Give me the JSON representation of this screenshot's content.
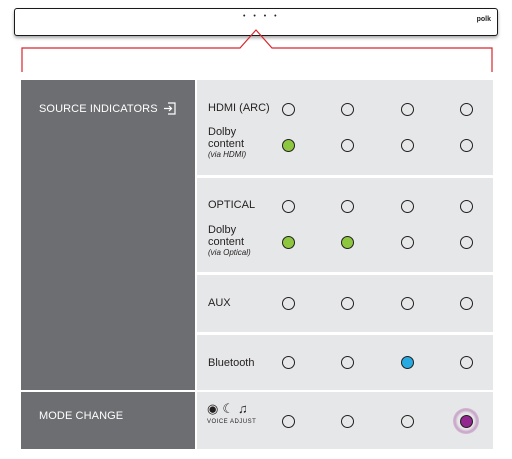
{
  "device": {
    "brand_logo": "polk",
    "dots": "• • • •"
  },
  "labels": {
    "source_indicators": "SOURCE INDICATORS",
    "mode_change": "MODE CHANGE"
  },
  "rows": [
    {
      "label": "HDMI (ARC)",
      "sub": "",
      "indicators": [
        "off",
        "off",
        "off-thick",
        "off-thick"
      ]
    },
    {
      "label": "Dolby content",
      "sub": "(via HDMI)",
      "indicators": [
        "green",
        "off",
        "off-thick",
        "off-thick"
      ]
    },
    {
      "label": "OPTICAL",
      "sub": "",
      "indicators": [
        "off",
        "off",
        "off-thick",
        "off-thick"
      ]
    },
    {
      "label": "Dolby content",
      "sub": "(via Optical)",
      "indicators": [
        "green",
        "green",
        "off-thick",
        "off-thick"
      ]
    },
    {
      "label": "AUX",
      "sub": "",
      "indicators": [
        "off",
        "off",
        "off",
        "off-thick"
      ]
    },
    {
      "label": "Bluetooth",
      "sub": "",
      "indicators": [
        "off-thick",
        "off",
        "blue",
        "off-thick"
      ]
    },
    {
      "label": "",
      "sub": "",
      "indicators": [
        "off",
        "off",
        "off-thick",
        "purple-glow"
      ]
    }
  ],
  "mode_icons": {
    "icons": [
      "movie-icon",
      "night-icon",
      "music-icon"
    ],
    "voice_adjust": "VOICE ADJUST"
  },
  "colors": {
    "panel": "#6d6e71",
    "row_bg": "#e6e7e8",
    "callout_line": "#d7262d",
    "green": "#8dc63f",
    "blue": "#27aae1",
    "purple": "#92278f"
  }
}
